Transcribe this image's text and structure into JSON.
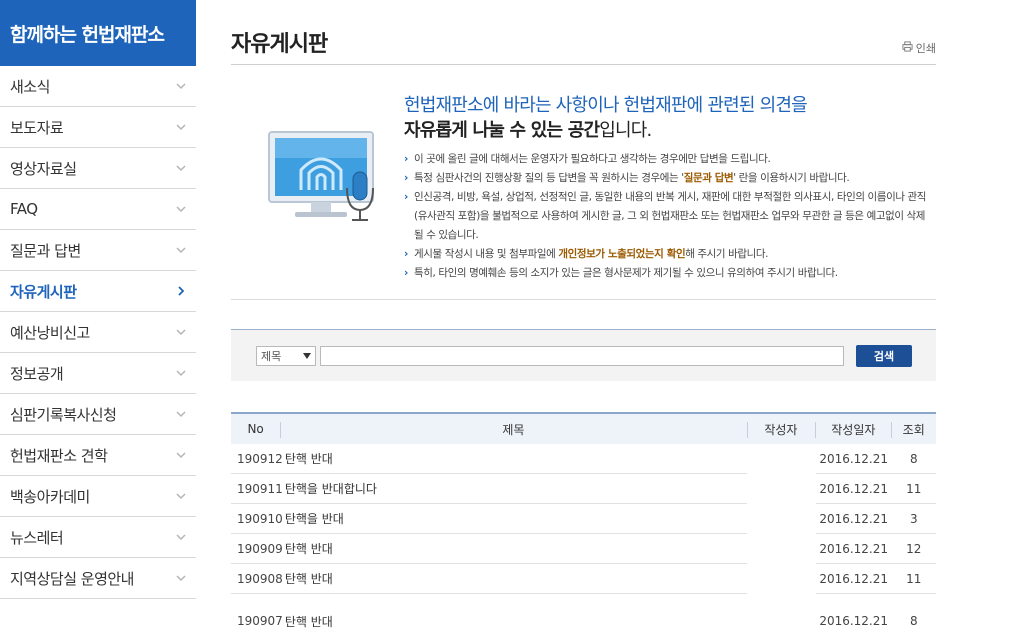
{
  "sidebar": {
    "title": "함께하는 헌법재판소",
    "items": [
      {
        "label": "새소식"
      },
      {
        "label": "보도자료"
      },
      {
        "label": "영상자료실"
      },
      {
        "label": "FAQ"
      },
      {
        "label": "질문과 답변"
      },
      {
        "label": "자유게시판",
        "active": true
      },
      {
        "label": "예산낭비신고"
      },
      {
        "label": "정보공개"
      },
      {
        "label": "심판기록복사신청"
      },
      {
        "label": "헌법재판소 견학"
      },
      {
        "label": "백송아카데미"
      },
      {
        "label": "뉴스레터"
      },
      {
        "label": "지역상담실 운영안내"
      }
    ]
  },
  "header": {
    "title": "자유게시판",
    "print_label": "인쇄"
  },
  "notice": {
    "headline_line1": "헌법재판소에 바라는 사항이나 헌법재판에 관련된 의견을",
    "headline_line2_strong": "자유롭게 나눌 수 있는 공간",
    "headline_line2_tail": "입니다.",
    "bullet1": "이 곳에 올린 글에 대해서는 운영자가 필요하다고 생각하는 경우에만 답변을 드립니다.",
    "bullet2_pre": "특정 심판사건의 진행상황 질의 등 답변을 꼭 원하시는 경우에는 '",
    "bullet2_hl": "질문과 답변",
    "bullet2_post": "' 란을 이용하시기 바랍니다.",
    "bullet3": "인신공격, 비방, 욕설, 상업적, 선정적인 글, 동일한 내용의 반복 게시, 재판에 대한 부적절한 의사표시, 타인의 이름이나 관직(유사관직 포함)을 불법적으로 사용하여 게시한 글, 그 외 헌법재판소 또는 헌법재판소 업무와 무관한 글 등은 예고없이 삭제될 수 있습니다.",
    "bullet4_pre": "게시물 작성시 내용 및 첨부파일에 ",
    "bullet4_hl": "개인정보가 노출되었는지 확인",
    "bullet4_post": "해 주시기 바랍니다.",
    "bullet5": "특히, 타인의 명예훼손 등의 소지가 있는 글은 형사문제가 제기될 수 있으니 유의하여 주시기 바랍니다."
  },
  "search": {
    "field_selected": "제목",
    "query": "",
    "button_label": "검색"
  },
  "table": {
    "headers": {
      "no": "No",
      "title": "제목",
      "author": "작성자",
      "date": "작성일자",
      "views": "조회"
    },
    "rows": [
      {
        "no": "190912",
        "title": "탄핵 반대",
        "author": "",
        "date": "2016.12.21",
        "views": "8"
      },
      {
        "no": "190911",
        "title": "탄핵을 반대합니다",
        "author": "",
        "date": "2016.12.21",
        "views": "11"
      },
      {
        "no": "190910",
        "title": "탄핵을 반대",
        "author": "",
        "date": "2016.12.21",
        "views": "3"
      },
      {
        "no": "190909",
        "title": "탄핵 반대",
        "author": "",
        "date": "2016.12.21",
        "views": "12"
      },
      {
        "no": "190908",
        "title": "탄핵 반대",
        "author": "",
        "date": "2016.12.21",
        "views": "11"
      },
      {
        "no": "190907",
        "title": "탄핵 반대",
        "author": "",
        "date": "2016.12.21",
        "views": "8"
      }
    ]
  },
  "colors": {
    "brand": "#1d64ba",
    "button": "#1d4f96",
    "highlight": "#9a5a00"
  },
  "icons": {
    "print": "printer-icon",
    "chevron": "chevron-down-icon",
    "active_chevron": "chevron-right-icon"
  }
}
